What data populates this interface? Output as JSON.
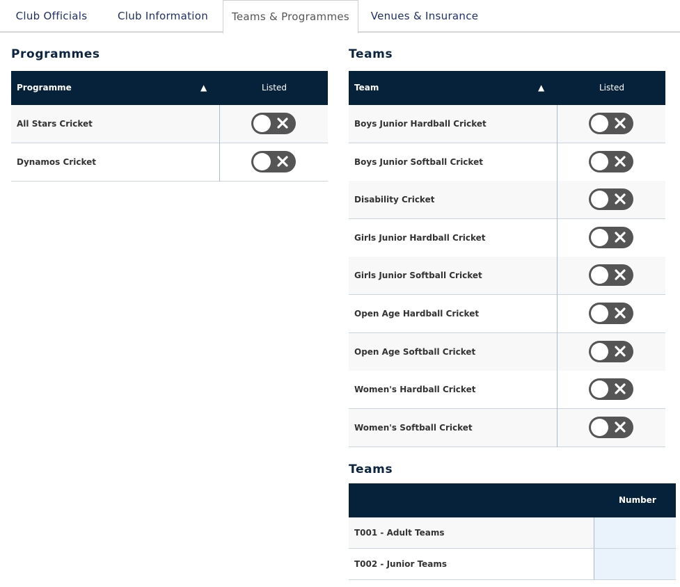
{
  "tabs": [
    {
      "label": "Club Officials",
      "active": false
    },
    {
      "label": "Club Information",
      "active": false
    },
    {
      "label": "Teams & Programmes",
      "active": true
    },
    {
      "label": "Venues & Insurance",
      "active": false
    }
  ],
  "programmes": {
    "title": "Programmes",
    "col_name": "Programme",
    "sort_glyph": "▲",
    "col_listed": "Listed",
    "rows": [
      {
        "name": "All Stars Cricket",
        "listed": false
      },
      {
        "name": "Dynamos Cricket",
        "listed": false
      }
    ]
  },
  "teams": {
    "title": "Teams",
    "col_name": "Team",
    "sort_glyph": "▲",
    "col_listed": "Listed",
    "rows": [
      {
        "name": "Boys Junior Hardball Cricket",
        "listed": false
      },
      {
        "name": "Boys Junior Softball Cricket",
        "listed": false
      },
      {
        "name": "Disability Cricket",
        "listed": false
      },
      {
        "name": "Girls Junior Hardball Cricket",
        "listed": false
      },
      {
        "name": "Girls Junior Softball Cricket",
        "listed": false
      },
      {
        "name": "Open Age Hardball Cricket",
        "listed": false
      },
      {
        "name": "Open Age Softball Cricket",
        "listed": false
      },
      {
        "name": "Women's Hardball Cricket",
        "listed": false
      },
      {
        "name": "Women's Softball Cricket",
        "listed": false
      }
    ]
  },
  "team_numbers": {
    "title": "Teams",
    "col_number": "Number",
    "rows": [
      {
        "name": "T001 - Adult Teams"
      },
      {
        "name": "T002 - Junior Teams"
      }
    ]
  },
  "colors": {
    "header_bg": "#06213a",
    "toggle_off": "#555555",
    "tab_text": "#1d2f6f"
  }
}
